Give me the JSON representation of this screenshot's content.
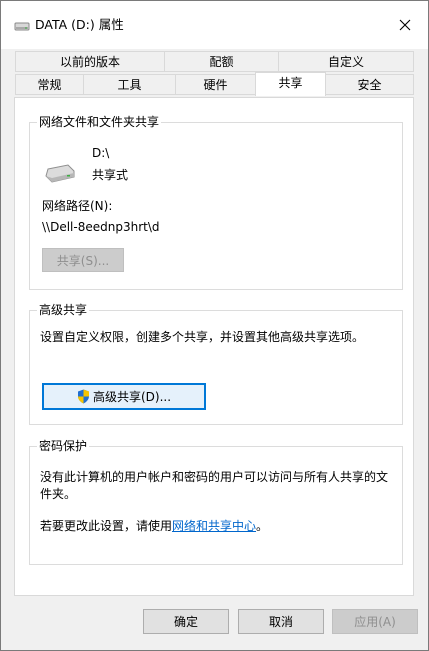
{
  "window": {
    "title": "DATA (D:) 属性"
  },
  "tabs_back": [
    {
      "label": "以前的版本"
    },
    {
      "label": "配额"
    },
    {
      "label": "自定义"
    }
  ],
  "tabs_front": [
    {
      "label": "常规"
    },
    {
      "label": "工具"
    },
    {
      "label": "硬件"
    },
    {
      "label": "共享",
      "active": true
    },
    {
      "label": "安全"
    }
  ],
  "network_share": {
    "group_title": "网络文件和文件夹共享",
    "drive_name": "D:\\",
    "drive_status": "共享式",
    "path_label": "网络路径(N):",
    "path_value": "\\\\Dell-8eednp3hrt\\d",
    "share_button": "共享(S)..."
  },
  "advanced_share": {
    "group_title": "高级共享",
    "description": "设置自定义权限，创建多个共享，并设置其他高级共享选项。",
    "button": "高级共享(D)..."
  },
  "password": {
    "group_title": "密码保护",
    "line1": "没有此计算机的用户帐户和密码的用户可以访问与所有人共享的文",
    "line2": "件夹。",
    "change_prefix": "若要更改此设置，请使用",
    "link_text": "网络和共享中心",
    "change_suffix": "。"
  },
  "footer": {
    "ok": "确定",
    "cancel": "取消",
    "apply": "应用(A)"
  },
  "colors": {
    "accent": "#0078d7",
    "link": "#0066cc",
    "shield_blue": "#1f6fd1",
    "shield_yellow": "#f5c400"
  }
}
